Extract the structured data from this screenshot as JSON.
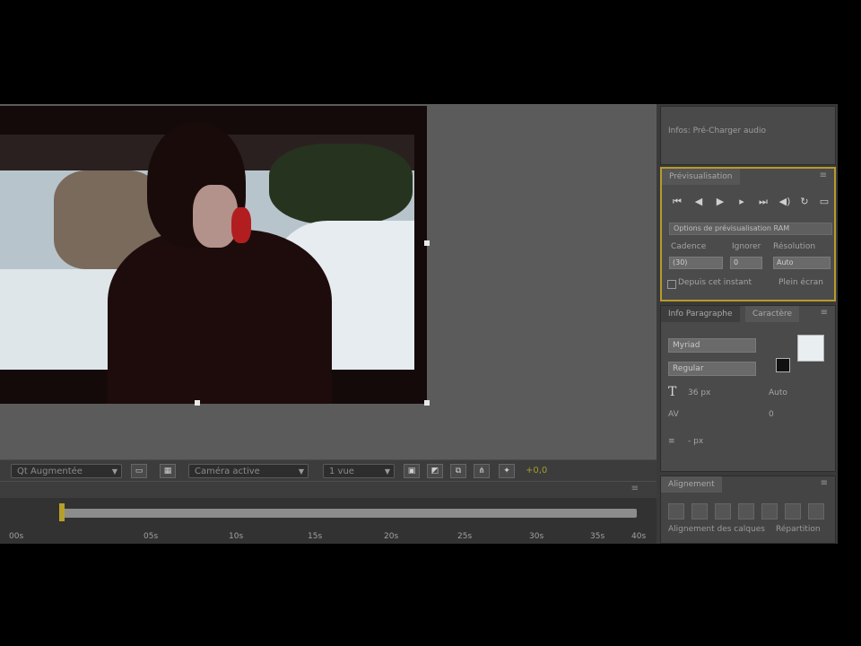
{
  "viewer": {
    "magnification": "Qt Augmentée",
    "view_mode": "Caméra active",
    "views": "1 vue",
    "accent_value": "+0,0"
  },
  "timeline": {
    "ruler": [
      "00s",
      "05s",
      "10s",
      "15s",
      "20s",
      "25s",
      "30s",
      "35s",
      "40s"
    ],
    "menu_icon": "panel-menu-icon"
  },
  "info_panel": {
    "line1": "Infos: Pré-Charger audio"
  },
  "preview_panel": {
    "tab": "Prévisualisation",
    "ram_options_label": "Options de prévisualisation RAM",
    "row_labels": {
      "framerate": "Cadence",
      "skip": "Ignorer",
      "resolution": "Résolution"
    },
    "framerate_value": "(30)",
    "skip_value": "0",
    "resolution_value": "Auto",
    "from_current": "Depuis cet instant",
    "fullscreen": "Plein écran"
  },
  "character_panel": {
    "tab_inactive": "Info Paragraphe",
    "tab_active": "Caractère",
    "font_family": "Myriad",
    "font_style": "Regular",
    "size": "36 px",
    "leading": "Auto",
    "tracking": "0",
    "stroke": "- px"
  },
  "align_panel": {
    "tab": "Alignement",
    "labels": [
      "Alignement des calques",
      "Répartition"
    ]
  },
  "colors": {
    "accent": "#b79b2b",
    "panel_bg": "#474747",
    "comp_bg": "#5b5b5b"
  }
}
